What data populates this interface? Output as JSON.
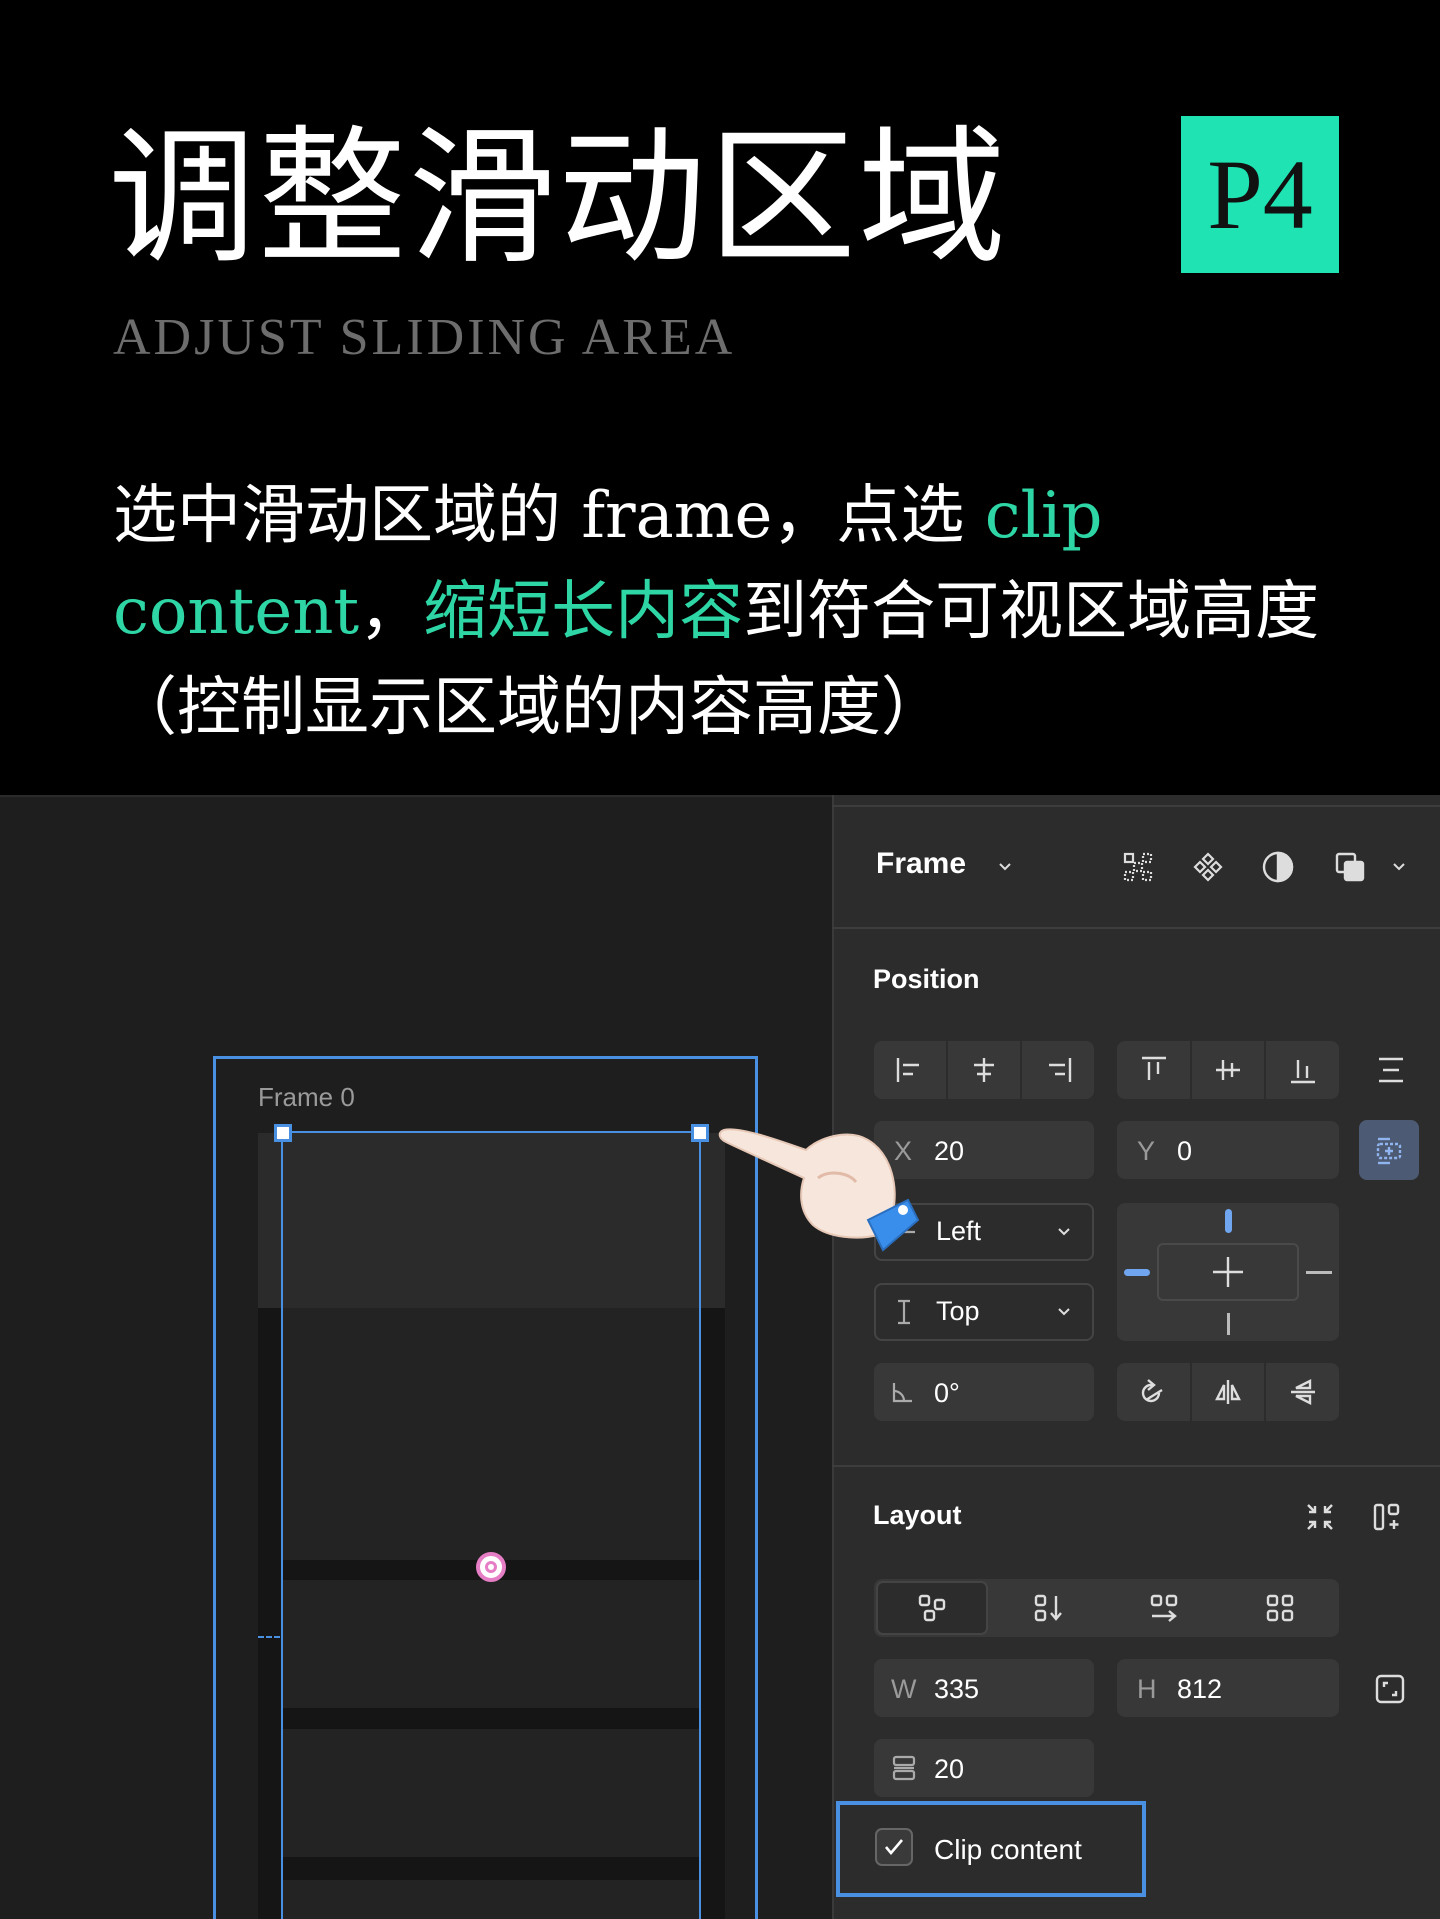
{
  "header": {
    "title_zh": "调整滑动区域",
    "badge": "P4",
    "subtitle_en": "ADJUST SLIDING AREA"
  },
  "description": {
    "part1": "选中滑动区域的 frame，点选 ",
    "hl1": "clip content",
    "part2": "，",
    "hl2": "缩短长内容",
    "part3": "到符合可视区域高度（控制显示区域的内容高度）"
  },
  "colors": {
    "accent": "#1fe3b2",
    "highlight_text": "#2fd6a5",
    "selection": "#4a90e2"
  },
  "canvas": {
    "frame_label": "Frame 0"
  },
  "panel": {
    "type_label": "Frame",
    "type_dropdown_icon": "chevron-down-icon",
    "top_icons": [
      "grid-icon",
      "component-icon",
      "mask-icon",
      "boolean-icon"
    ],
    "position": {
      "title": "Position",
      "x_label": "X",
      "x_value": "20",
      "y_label": "Y",
      "y_value": "0",
      "h_constraint": "Left",
      "v_constraint": "Top",
      "rotation": "0°"
    },
    "layout": {
      "title": "Layout",
      "w_label": "W",
      "w_value": "335",
      "h_label": "H",
      "h_value": "812",
      "gap_value": "20",
      "clip_content_label": "Clip content",
      "clip_content_checked": true
    }
  }
}
